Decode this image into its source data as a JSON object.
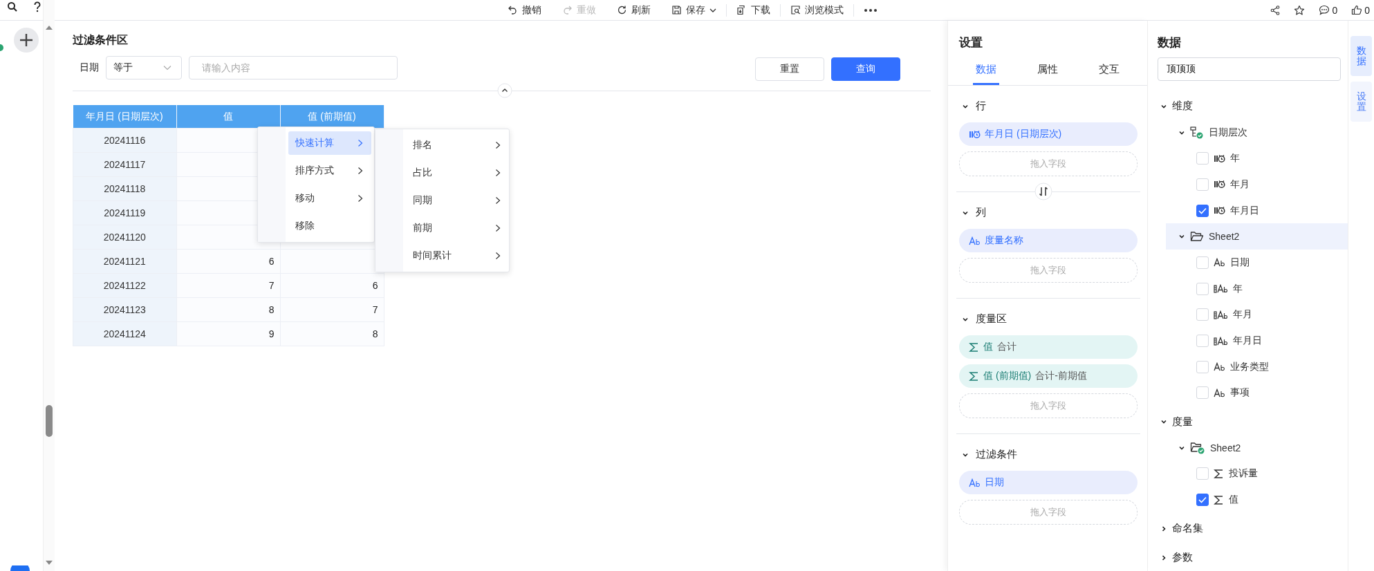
{
  "toolbar": {
    "items": [
      {
        "label": "撤销",
        "disabled": false,
        "dropdown": false
      },
      {
        "label": "重做",
        "disabled": true,
        "dropdown": false
      },
      {
        "label": "刷新",
        "disabled": false,
        "dropdown": false
      },
      {
        "label": "保存",
        "disabled": false,
        "dropdown": true
      },
      {
        "label": "下载",
        "disabled": false,
        "dropdown": false
      },
      {
        "label": "浏览模式",
        "disabled": false,
        "dropdown": false
      }
    ],
    "comment_count": "0",
    "like_count": "0"
  },
  "filter": {
    "title": "过滤条件区",
    "field_label": "日期",
    "operator": "等于",
    "placeholder": "请输入内容",
    "buttons": [
      {
        "label": "重置",
        "primary": false
      },
      {
        "label": "查询",
        "primary": true
      }
    ]
  },
  "table": {
    "columns": [
      "年月日 (日期层次)",
      "值",
      "值 (前期值)"
    ],
    "rows": [
      {
        "date": "20241116"
      },
      {
        "date": "20241117"
      },
      {
        "date": "20241118"
      },
      {
        "date": "20241119"
      },
      {
        "date": "20241120"
      },
      {
        "date": "20241121",
        "value": "6"
      },
      {
        "date": "20241122",
        "value": "7",
        "previous": "6"
      },
      {
        "date": "20241123",
        "value": "8",
        "previous": "7"
      },
      {
        "date": "20241124",
        "value": "9",
        "previous": "8"
      }
    ]
  },
  "context_menu": {
    "items": [
      {
        "label": "快速计算",
        "selected": true,
        "has_submenu": true
      },
      {
        "label": "排序方式",
        "selected": false,
        "has_submenu": true
      },
      {
        "label": "移动",
        "selected": false,
        "has_submenu": true
      },
      {
        "label": "移除",
        "selected": false,
        "has_submenu": false
      }
    ],
    "submenu": [
      {
        "label": "排名"
      },
      {
        "label": "占比"
      },
      {
        "label": "同期"
      },
      {
        "label": "前期"
      },
      {
        "label": "时间累计"
      }
    ]
  },
  "settings": {
    "title": "设置",
    "tabs": [
      {
        "label": "数据",
        "selected": true
      },
      {
        "label": "属性",
        "selected": false
      },
      {
        "label": "交互",
        "selected": false
      }
    ],
    "sections": [
      {
        "title": "行",
        "expanded": true,
        "fields": [
          {
            "label": "年月日 (日期层次)",
            "kind": "date"
          }
        ],
        "drop_hint": "拖入字段",
        "swap": true
      },
      {
        "title": "列",
        "expanded": true,
        "fields": [
          {
            "label": "度量名称",
            "kind": "text"
          }
        ],
        "drop_hint": "拖入字段"
      },
      {
        "title": "度量区",
        "expanded": true,
        "fields": [
          {
            "label": "值",
            "aggregation": "合计",
            "kind": "measure"
          },
          {
            "label": "值 (前期值)",
            "aggregation": "合计-前期值",
            "kind": "measure"
          }
        ],
        "drop_hint": "拖入字段"
      },
      {
        "title": "过滤条件",
        "expanded": true,
        "fields": [
          {
            "label": "日期",
            "kind": "text"
          }
        ],
        "drop_hint": "拖入字段"
      }
    ]
  },
  "data": {
    "title": "数据",
    "search_value": "顶顶顶",
    "tree": [
      {
        "label": "维度",
        "expanded": true,
        "children": [
          {
            "label": "日期层次",
            "kind": "hierarchy",
            "expanded": true,
            "selected": false,
            "children": [
              {
                "label": "年",
                "kind": "date",
                "checked": false
              },
              {
                "label": "年月",
                "kind": "date",
                "checked": false
              },
              {
                "label": "年月日",
                "kind": "date",
                "checked": true
              }
            ]
          },
          {
            "label": "Sheet2",
            "kind": "folder",
            "expanded": true,
            "selected": true,
            "children": [
              {
                "label": "日期",
                "kind": "text",
                "checked": false
              },
              {
                "label": "年",
                "kind": "text_date",
                "checked": false
              },
              {
                "label": "年月",
                "kind": "text_date",
                "checked": false
              },
              {
                "label": "年月日",
                "kind": "text_date",
                "checked": false
              },
              {
                "label": "业务类型",
                "kind": "text",
                "checked": false
              },
              {
                "label": "事项",
                "kind": "text",
                "checked": false
              }
            ]
          }
        ]
      },
      {
        "label": "度量",
        "expanded": true,
        "children": [
          {
            "label": "Sheet2",
            "kind": "folder_checked",
            "expanded": true,
            "selected": false,
            "children": [
              {
                "label": "投诉量",
                "kind": "measure",
                "checked": false
              },
              {
                "label": "值",
                "kind": "measure",
                "checked": true
              }
            ]
          }
        ]
      },
      {
        "label": "命名集",
        "expanded": false
      },
      {
        "label": "参数",
        "expanded": false
      }
    ]
  },
  "side_tabs": [
    {
      "label": "数据",
      "selected": true
    },
    {
      "label": "设置",
      "selected": false
    }
  ]
}
